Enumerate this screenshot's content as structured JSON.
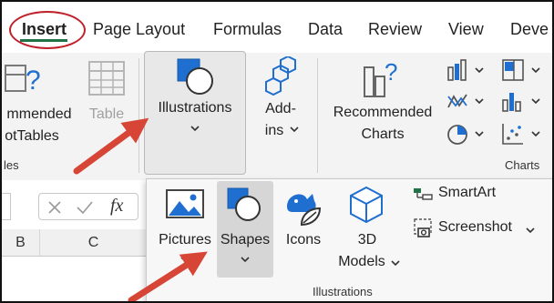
{
  "tabs": [
    {
      "label": "Insert",
      "active": true
    },
    {
      "label": "Page Layout"
    },
    {
      "label": "Formulas"
    },
    {
      "label": "Data"
    },
    {
      "label": "Review"
    },
    {
      "label": "View"
    },
    {
      "label": "Deve"
    }
  ],
  "ribbon": {
    "pivot_label_1": "mmended",
    "pivot_label_2": "otTables",
    "table_label": "Table",
    "tables_group_label": "les",
    "illustrations_label": "Illustrations",
    "addins_label_1": "Add-",
    "addins_label_2": "ins",
    "rec_charts_label_1": "Recommended",
    "rec_charts_label_2": "Charts",
    "charts_group_label": "Charts"
  },
  "dropdown": {
    "pictures": "Pictures",
    "shapes": "Shapes",
    "icons": "Icons",
    "models_1": "3D",
    "models_2": "Models",
    "smartart": "SmartArt",
    "screenshot": "Screenshot",
    "group_label": "Illustrations"
  },
  "sheet": {
    "fx": "fx",
    "columns": [
      "B",
      "C"
    ]
  },
  "colors": {
    "accent_green": "#217346",
    "annotation_red": "#c0202a",
    "icon_blue": "#1e6fd0"
  }
}
